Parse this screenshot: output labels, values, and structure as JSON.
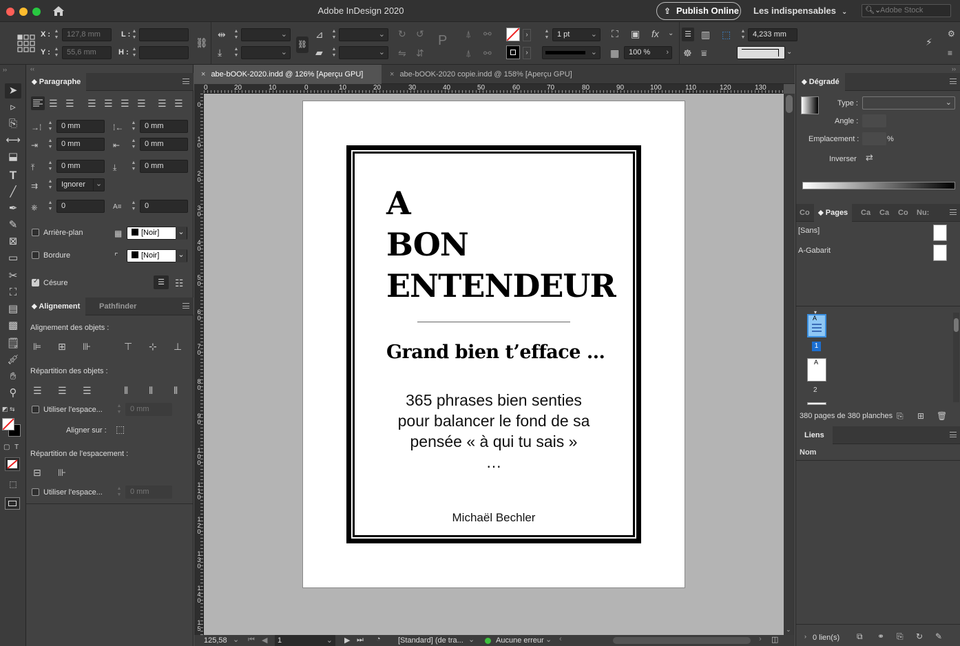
{
  "app": {
    "title": "Adobe InDesign 2020",
    "publish_label": "Publish Online",
    "workspace": "Les indispensables",
    "search_placeholder": "Adobe Stock"
  },
  "control": {
    "x_label": "X :",
    "x_value": "127,8 mm",
    "y_label": "Y :",
    "y_value": "55,6 mm",
    "w_label": "L :",
    "h_label": "H :",
    "stroke_weight": "1 pt",
    "zoom": "100 %",
    "offset": "4,233 mm"
  },
  "toolbar": {
    "stroke_letter": "T"
  },
  "paragraph": {
    "tab": "Paragraphe",
    "left_indent": "0 mm",
    "right_indent": "0 mm",
    "first_indent": "0 mm",
    "last_indent": "0 mm",
    "space_before": "0 mm",
    "space_after": "0 mm",
    "align_grid": "Ignorer",
    "drop_lines": "0",
    "drop_chars": "0",
    "shading_label": "Arrière-plan",
    "shading_color": "[Noir]",
    "border_label": "Bordure",
    "border_color": "[Noir]",
    "hyphen_label": "Césure"
  },
  "align_panel": {
    "tab_align": "Alignement",
    "tab_path": "Pathfinder",
    "align_objects": "Alignement des objets :",
    "distribute_objects": "Répartition des objets :",
    "use_spacing": "Utiliser l'espace...",
    "spacing_value": "0 mm",
    "align_to": "Aligner sur :",
    "distribute_spacing": "Répartition de l'espacement :",
    "use_spacing2": "Utiliser l'espace...",
    "spacing_value2": "0 mm"
  },
  "tabs": [
    {
      "label": "abe-bOOK-2020.indd @ 126% [Aperçu GPU]",
      "close": "×"
    },
    {
      "label": "abe-bOOK-2020 copie.indd @ 158% [Aperçu GPU]",
      "close": "×"
    }
  ],
  "ruler_h": [
    "0",
    "20",
    "10",
    "0",
    "10",
    "20",
    "30",
    "40",
    "50",
    "60",
    "70",
    "80",
    "90",
    "100",
    "110",
    "120",
    "130"
  ],
  "ruler_v": [
    "0",
    "1 0",
    "2 0",
    "3 0",
    "4 0",
    "5 0",
    "6 0",
    "7 0",
    "8 0",
    "9 0",
    "1 0 0",
    "1 1 0",
    "1 2 0",
    "1 3 0",
    "1 4 0",
    "1 5"
  ],
  "document": {
    "title_lines": [
      "A",
      "BON",
      "ENTENDEUR"
    ],
    "subtitle": "Grand bien t’efface …",
    "body_lines": [
      "365 phrases bien senties",
      "pour balancer le fond de sa",
      "pensée « à qui tu sais »",
      "…"
    ],
    "author": "Michaël Bechler"
  },
  "status": {
    "zoom": "125,58",
    "page": "1",
    "style": "[Standard] (de tra...",
    "preflight": "Aucune erreur"
  },
  "gradient": {
    "tab": "Dégradé",
    "type_label": "Type :",
    "angle_label": "Angle :",
    "location_label": "Emplacement :",
    "percent": "%",
    "reverse_label": "Inverser"
  },
  "pages": {
    "tabs": [
      "Co",
      "Pages",
      "Ca",
      "Ca",
      "Co",
      "Nu:"
    ],
    "masters": [
      "[Sans]",
      "A-Gabarit"
    ],
    "page_labels": [
      "1",
      "2"
    ],
    "thumb_letter": "A",
    "summary": "380 pages de 380 planches"
  },
  "links": {
    "tab": "Liens",
    "col_name": "Nom",
    "count": "0 lien(s)"
  }
}
